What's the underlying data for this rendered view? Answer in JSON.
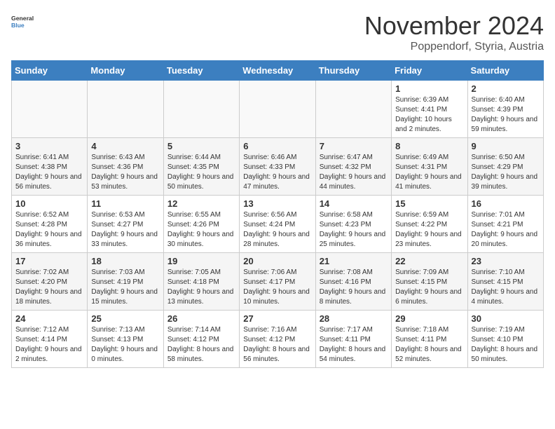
{
  "logo": {
    "text_general": "General",
    "text_blue": "Blue"
  },
  "title": "November 2024",
  "location": "Poppendorf, Styria, Austria",
  "weekdays": [
    "Sunday",
    "Monday",
    "Tuesday",
    "Wednesday",
    "Thursday",
    "Friday",
    "Saturday"
  ],
  "weeks": [
    [
      {
        "day": "",
        "info": ""
      },
      {
        "day": "",
        "info": ""
      },
      {
        "day": "",
        "info": ""
      },
      {
        "day": "",
        "info": ""
      },
      {
        "day": "",
        "info": ""
      },
      {
        "day": "1",
        "info": "Sunrise: 6:39 AM\nSunset: 4:41 PM\nDaylight: 10 hours and 2 minutes."
      },
      {
        "day": "2",
        "info": "Sunrise: 6:40 AM\nSunset: 4:39 PM\nDaylight: 9 hours and 59 minutes."
      }
    ],
    [
      {
        "day": "3",
        "info": "Sunrise: 6:41 AM\nSunset: 4:38 PM\nDaylight: 9 hours and 56 minutes."
      },
      {
        "day": "4",
        "info": "Sunrise: 6:43 AM\nSunset: 4:36 PM\nDaylight: 9 hours and 53 minutes."
      },
      {
        "day": "5",
        "info": "Sunrise: 6:44 AM\nSunset: 4:35 PM\nDaylight: 9 hours and 50 minutes."
      },
      {
        "day": "6",
        "info": "Sunrise: 6:46 AM\nSunset: 4:33 PM\nDaylight: 9 hours and 47 minutes."
      },
      {
        "day": "7",
        "info": "Sunrise: 6:47 AM\nSunset: 4:32 PM\nDaylight: 9 hours and 44 minutes."
      },
      {
        "day": "8",
        "info": "Sunrise: 6:49 AM\nSunset: 4:31 PM\nDaylight: 9 hours and 41 minutes."
      },
      {
        "day": "9",
        "info": "Sunrise: 6:50 AM\nSunset: 4:29 PM\nDaylight: 9 hours and 39 minutes."
      }
    ],
    [
      {
        "day": "10",
        "info": "Sunrise: 6:52 AM\nSunset: 4:28 PM\nDaylight: 9 hours and 36 minutes."
      },
      {
        "day": "11",
        "info": "Sunrise: 6:53 AM\nSunset: 4:27 PM\nDaylight: 9 hours and 33 minutes."
      },
      {
        "day": "12",
        "info": "Sunrise: 6:55 AM\nSunset: 4:26 PM\nDaylight: 9 hours and 30 minutes."
      },
      {
        "day": "13",
        "info": "Sunrise: 6:56 AM\nSunset: 4:24 PM\nDaylight: 9 hours and 28 minutes."
      },
      {
        "day": "14",
        "info": "Sunrise: 6:58 AM\nSunset: 4:23 PM\nDaylight: 9 hours and 25 minutes."
      },
      {
        "day": "15",
        "info": "Sunrise: 6:59 AM\nSunset: 4:22 PM\nDaylight: 9 hours and 23 minutes."
      },
      {
        "day": "16",
        "info": "Sunrise: 7:01 AM\nSunset: 4:21 PM\nDaylight: 9 hours and 20 minutes."
      }
    ],
    [
      {
        "day": "17",
        "info": "Sunrise: 7:02 AM\nSunset: 4:20 PM\nDaylight: 9 hours and 18 minutes."
      },
      {
        "day": "18",
        "info": "Sunrise: 7:03 AM\nSunset: 4:19 PM\nDaylight: 9 hours and 15 minutes."
      },
      {
        "day": "19",
        "info": "Sunrise: 7:05 AM\nSunset: 4:18 PM\nDaylight: 9 hours and 13 minutes."
      },
      {
        "day": "20",
        "info": "Sunrise: 7:06 AM\nSunset: 4:17 PM\nDaylight: 9 hours and 10 minutes."
      },
      {
        "day": "21",
        "info": "Sunrise: 7:08 AM\nSunset: 4:16 PM\nDaylight: 9 hours and 8 minutes."
      },
      {
        "day": "22",
        "info": "Sunrise: 7:09 AM\nSunset: 4:15 PM\nDaylight: 9 hours and 6 minutes."
      },
      {
        "day": "23",
        "info": "Sunrise: 7:10 AM\nSunset: 4:15 PM\nDaylight: 9 hours and 4 minutes."
      }
    ],
    [
      {
        "day": "24",
        "info": "Sunrise: 7:12 AM\nSunset: 4:14 PM\nDaylight: 9 hours and 2 minutes."
      },
      {
        "day": "25",
        "info": "Sunrise: 7:13 AM\nSunset: 4:13 PM\nDaylight: 9 hours and 0 minutes."
      },
      {
        "day": "26",
        "info": "Sunrise: 7:14 AM\nSunset: 4:12 PM\nDaylight: 8 hours and 58 minutes."
      },
      {
        "day": "27",
        "info": "Sunrise: 7:16 AM\nSunset: 4:12 PM\nDaylight: 8 hours and 56 minutes."
      },
      {
        "day": "28",
        "info": "Sunrise: 7:17 AM\nSunset: 4:11 PM\nDaylight: 8 hours and 54 minutes."
      },
      {
        "day": "29",
        "info": "Sunrise: 7:18 AM\nSunset: 4:11 PM\nDaylight: 8 hours and 52 minutes."
      },
      {
        "day": "30",
        "info": "Sunrise: 7:19 AM\nSunset: 4:10 PM\nDaylight: 8 hours and 50 minutes."
      }
    ]
  ]
}
